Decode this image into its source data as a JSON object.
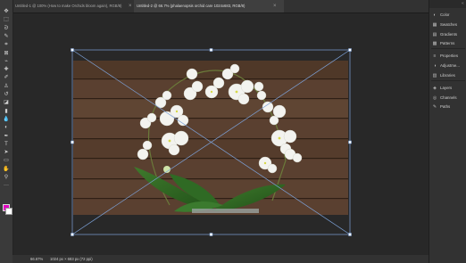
{
  "tabs": [
    {
      "label": "Untitled-1 @ 100% (How to make Orchids bloom again), RGB/8)",
      "active": false
    },
    {
      "label": "Untitled-2 @ 66.7% (phalaenopsis orchid care 1024x683, RGB/8)",
      "active": true
    }
  ],
  "tab_close_glyph": "×",
  "tools": [
    {
      "name": "move-tool-icon",
      "glyph": "✥"
    },
    {
      "name": "marquee-tool-icon",
      "glyph": "⬚"
    },
    {
      "name": "lasso-tool-icon",
      "glyph": "ᘐ"
    },
    {
      "name": "quick-select-tool-icon",
      "glyph": "✎"
    },
    {
      "name": "crop-tool-icon",
      "glyph": "⌗"
    },
    {
      "name": "frame-tool-icon",
      "glyph": "⊠"
    },
    {
      "name": "eyedropper-tool-icon",
      "glyph": "⌁"
    },
    {
      "name": "healing-brush-tool-icon",
      "glyph": "✚"
    },
    {
      "name": "brush-tool-icon",
      "glyph": "✐"
    },
    {
      "name": "clone-stamp-tool-icon",
      "glyph": "♙"
    },
    {
      "name": "history-brush-tool-icon",
      "glyph": "↺"
    },
    {
      "name": "eraser-tool-icon",
      "glyph": "◪"
    },
    {
      "name": "gradient-tool-icon",
      "glyph": "▮"
    },
    {
      "name": "blur-tool-icon",
      "glyph": "💧"
    },
    {
      "name": "dodge-tool-icon",
      "glyph": "◐"
    },
    {
      "name": "pen-tool-icon",
      "glyph": "✒"
    },
    {
      "name": "type-tool-icon",
      "glyph": "T"
    },
    {
      "name": "path-select-tool-icon",
      "glyph": "➤"
    },
    {
      "name": "rectangle-tool-icon",
      "glyph": "▭"
    },
    {
      "name": "hand-tool-icon",
      "glyph": "✋"
    },
    {
      "name": "zoom-tool-icon",
      "glyph": "⚲"
    },
    {
      "name": "more-tools-icon",
      "glyph": "···"
    }
  ],
  "panels": [
    {
      "name": "color",
      "label": "Color",
      "icon": "◐",
      "icon_name": "color-panel-icon"
    },
    {
      "name": "swatches",
      "label": "Swatches",
      "icon": "▦",
      "icon_name": "swatches-panel-icon"
    },
    {
      "name": "gradients",
      "label": "Gradients",
      "icon": "▤",
      "icon_name": "gradients-panel-icon"
    },
    {
      "name": "patterns",
      "label": "Patterns",
      "icon": "▩",
      "icon_name": "patterns-panel-icon"
    },
    {
      "name": "properties",
      "label": "Properties",
      "icon": "≡",
      "icon_name": "properties-panel-icon"
    },
    {
      "name": "adjustments",
      "label": "Adjustme...",
      "icon": "◑",
      "icon_name": "adjustments-panel-icon"
    },
    {
      "name": "libraries",
      "label": "Libraries",
      "icon": "▥",
      "icon_name": "libraries-panel-icon"
    },
    {
      "name": "layers",
      "label": "Layers",
      "icon": "◈",
      "icon_name": "layers-panel-icon"
    },
    {
      "name": "channels",
      "label": "Channels",
      "icon": "◎",
      "icon_name": "channels-panel-icon"
    },
    {
      "name": "paths",
      "label": "Paths",
      "icon": "✎",
      "icon_name": "paths-panel-icon"
    }
  ],
  "status": {
    "zoom": "66.67%",
    "doc_info": "1024 px × 683 px (72 ppi)"
  },
  "colors": {
    "foreground": "#e000c0",
    "background": "#ffffff",
    "transform_box": "#7da2d8",
    "wood": "#5a4030"
  }
}
